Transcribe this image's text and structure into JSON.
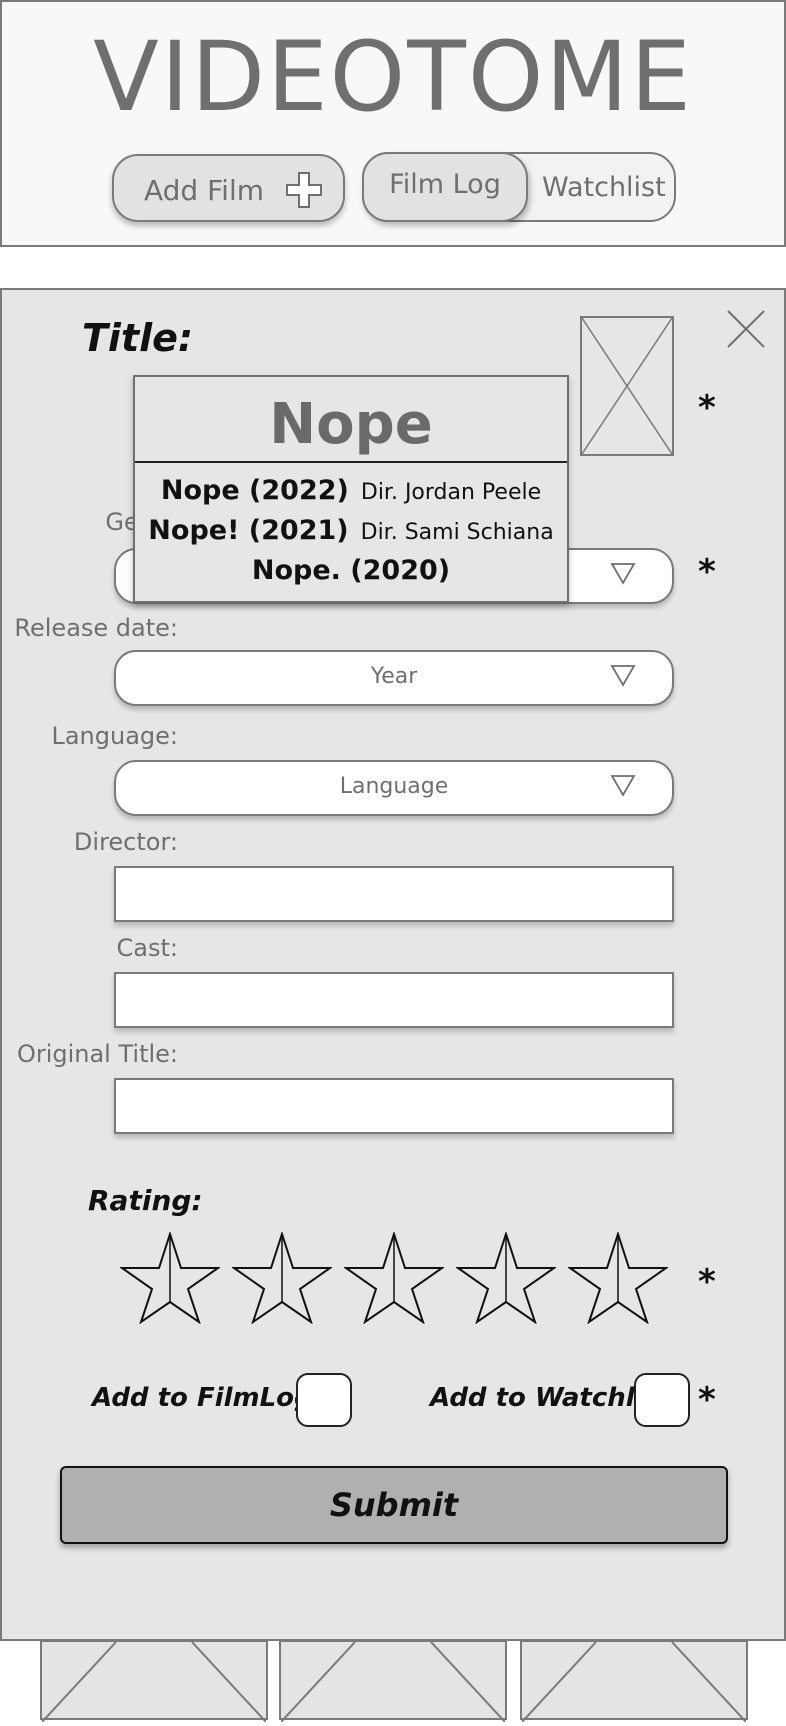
{
  "header": {
    "app_title": "VIDEOTOME",
    "add_film_label": "Add Film",
    "segment": {
      "film_log": "Film Log",
      "watchlist": "Watchlist",
      "selected": "Film Log"
    }
  },
  "form": {
    "title_label": "Title:",
    "required_marker": "*",
    "title_search": {
      "query": "Nope",
      "suggestions": [
        {
          "title": "Nope (2022)",
          "director": "Dir. Jordan Peele"
        },
        {
          "title": "Nope! (2021)",
          "director": "Dir. Sami Schiana"
        },
        {
          "title": "Nope. (2020)",
          "director": ""
        }
      ]
    },
    "genre_label": "Genre",
    "release_date_label": "Release date:",
    "release_year_value": "Year",
    "language_label": "Language:",
    "language_value": "Language",
    "director_label": "Director:",
    "cast_label": "Cast:",
    "original_title_label": "Original Title:",
    "rating_label": "Rating:",
    "rating_value": 0,
    "rating_max": 5,
    "add_filmlog_label": "Add to FilmLog",
    "add_watchlist_label": "Add to Watchlist",
    "add_filmlog_checked": false,
    "add_watchlist_checked": false,
    "submit_label": "Submit"
  },
  "icons": [
    "plus-icon",
    "close-icon",
    "image-placeholder-icon",
    "dropdown-triangle-icon",
    "star-icon"
  ]
}
